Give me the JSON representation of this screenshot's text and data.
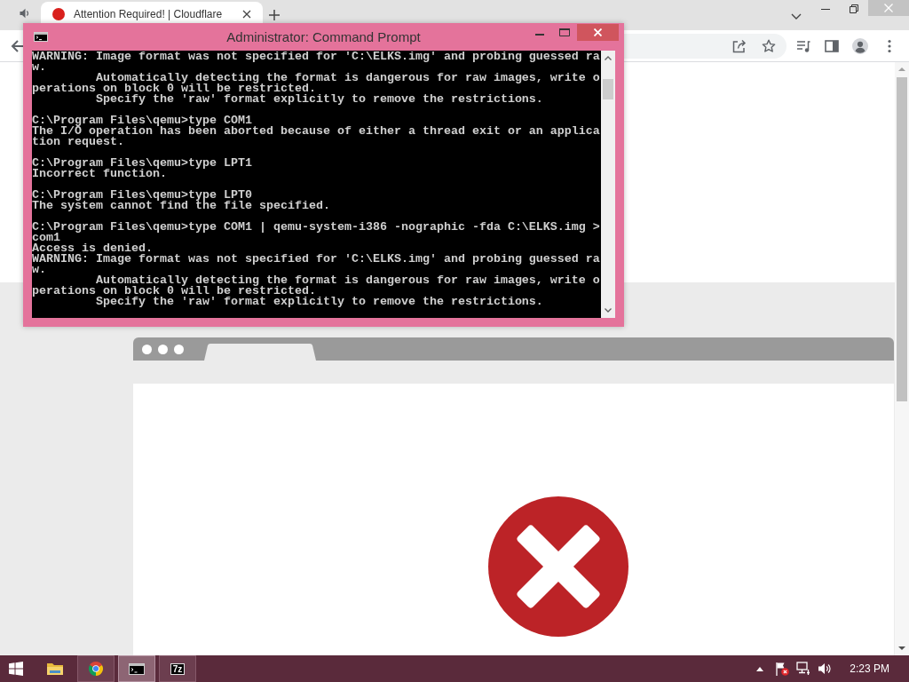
{
  "browser": {
    "tabs": [
      {
        "title": "Attention Required! | Cloudflare",
        "selected": true
      }
    ]
  },
  "cmd_window": {
    "title": "Administrator: Command Prompt",
    "console": {
      "blocks": [
        [
          "WARNING: Image format was not specified for 'C:\\ELKS.img' and probing guessed ra",
          "w.",
          "         Automatically detecting the format is dangerous for raw images, write o",
          "perations on block 0 will be restricted.",
          "         Specify the 'raw' format explicitly to remove the restrictions."
        ],
        [
          "C:\\Program Files\\qemu>type COM1",
          "The I/O operation has been aborted because of either a thread exit or an applica",
          "tion request."
        ],
        [
          "C:\\Program Files\\qemu>type LPT1",
          "Incorrect function."
        ],
        [
          "C:\\Program Files\\qemu>type LPT0",
          "The system cannot find the file specified."
        ],
        [
          "C:\\Program Files\\qemu>type COM1 | qemu-system-i386 -nographic -fda C:\\ELKS.img >",
          "com1",
          "Access is denied.",
          "WARNING: Image format was not specified for 'C:\\ELKS.img' and probing guessed ra",
          "w.",
          "         Automatically detecting the format is dangerous for raw images, write o",
          "perations on block 0 will be restricted.",
          "         Specify the 'raw' format explicitly to remove the restrictions."
        ]
      ]
    }
  },
  "taskbar": {
    "apps": [
      {
        "kind": "folder",
        "running": false,
        "selected": false
      },
      {
        "kind": "browser",
        "running": true,
        "selected": false
      },
      {
        "kind": "terminal",
        "running": true,
        "selected": true
      },
      {
        "kind": "archiver",
        "label": "7z",
        "running": true,
        "selected": false
      }
    ],
    "clock": "2:23 PM"
  }
}
